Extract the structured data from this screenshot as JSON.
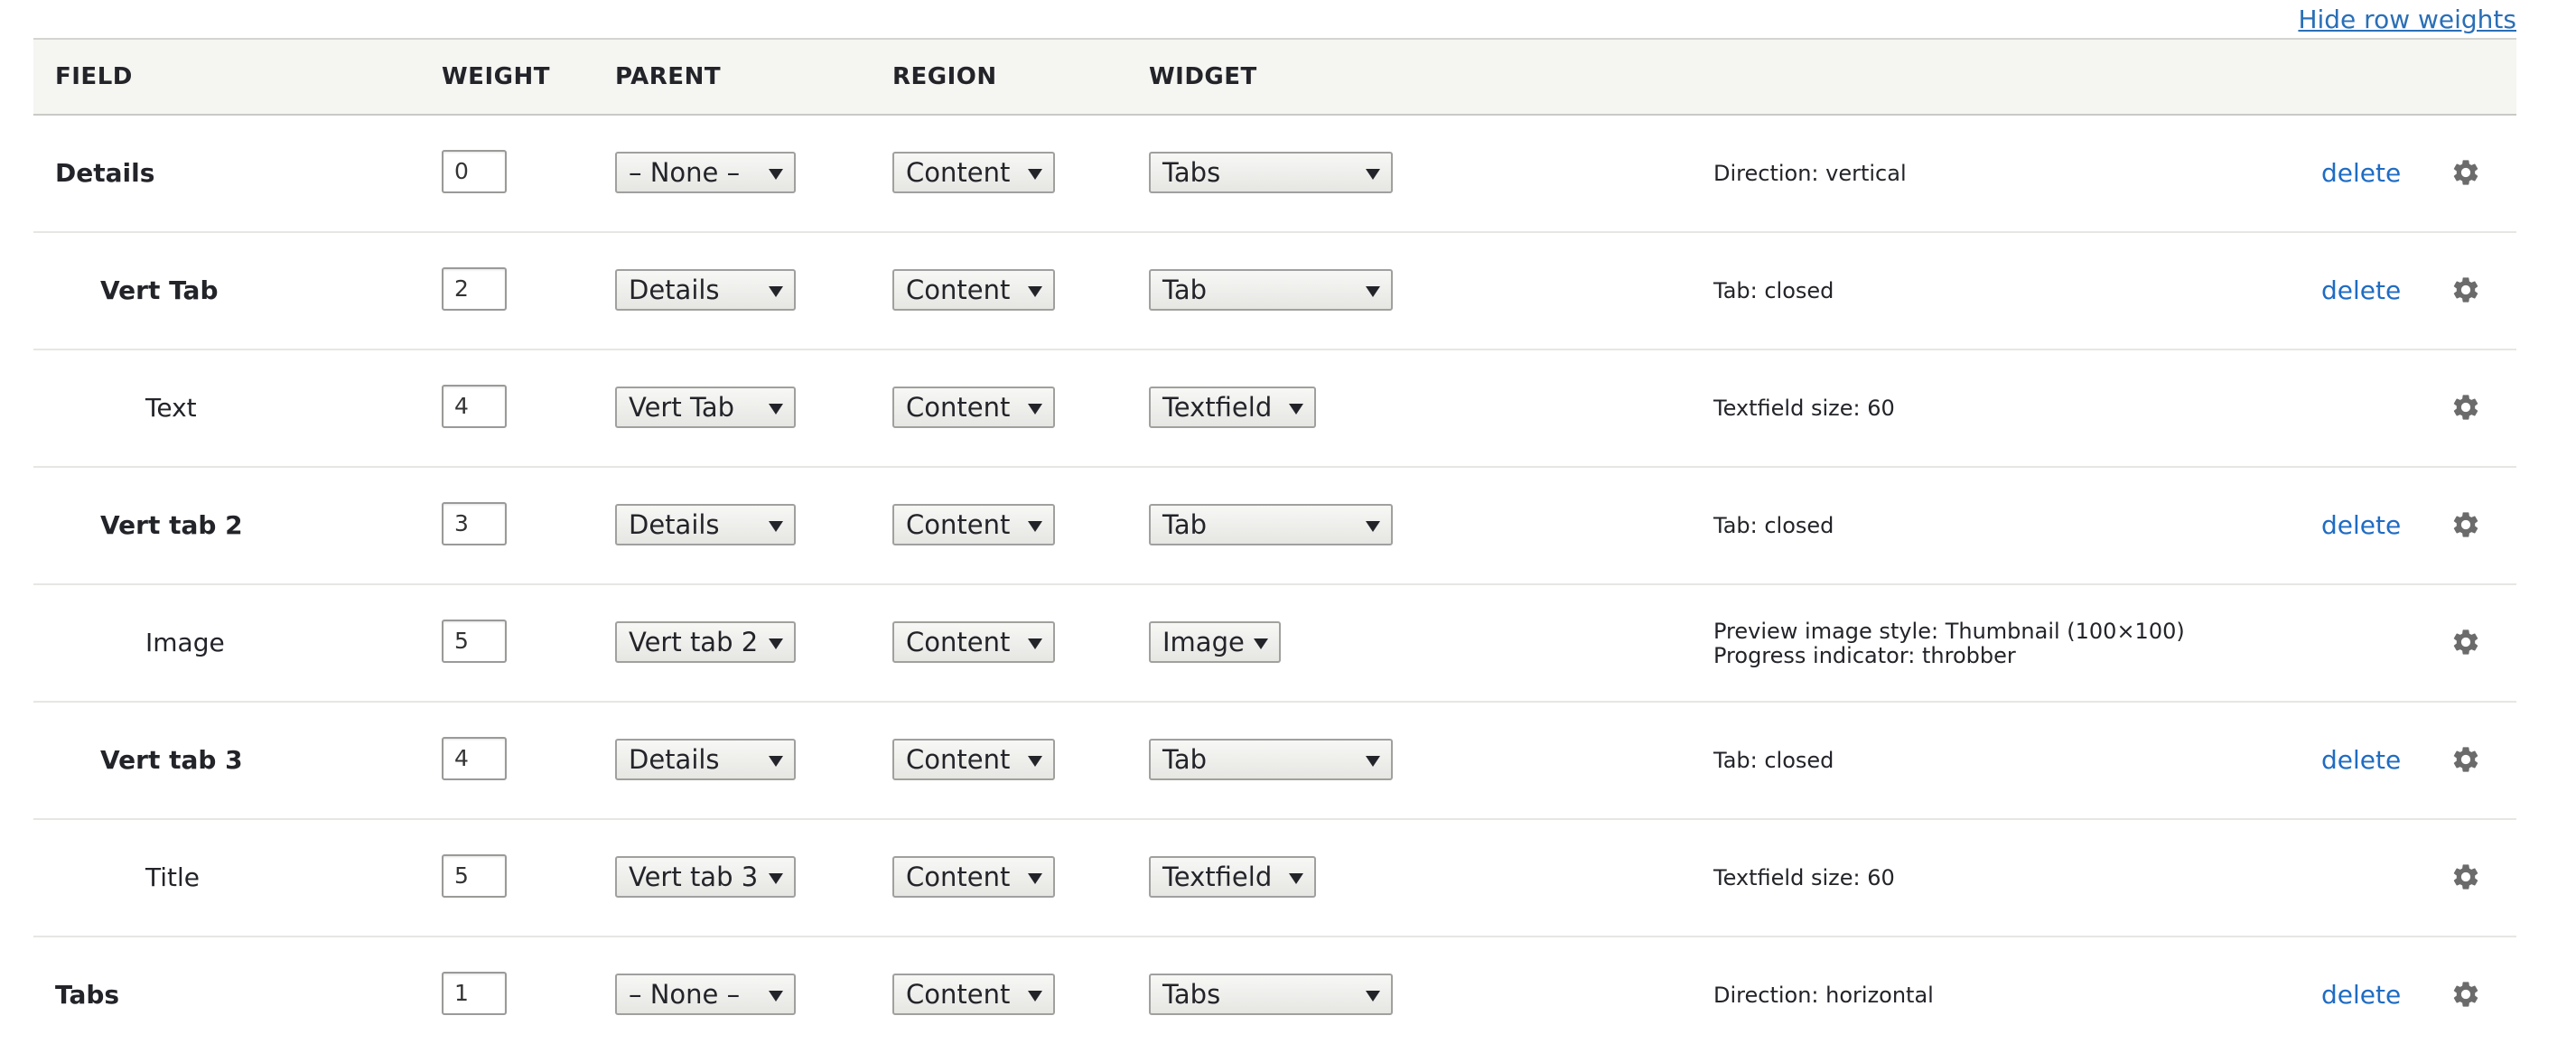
{
  "top_link": "Hide row weights",
  "headers": {
    "field": "Field",
    "weight": "Weight",
    "parent": "Parent",
    "region": "Region",
    "widget": "Widget"
  },
  "rows": [
    {
      "label": "Details",
      "weight": "0",
      "parent": "– None –",
      "region": "Content",
      "widget": "Tabs",
      "summary": [
        "Direction: vertical"
      ],
      "delete": "delete"
    },
    {
      "label": "Vert Tab",
      "weight": "2",
      "parent": "Details",
      "region": "Content",
      "widget": "Tab",
      "summary": [
        "Tab: closed"
      ],
      "delete": "delete"
    },
    {
      "label": "Text",
      "weight": "4",
      "parent": "Vert Tab",
      "region": "Content",
      "widget": "Textfield",
      "summary": [
        "Textfield size: 60"
      ],
      "delete": ""
    },
    {
      "label": "Vert tab 2",
      "weight": "3",
      "parent": "Details",
      "region": "Content",
      "widget": "Tab",
      "summary": [
        "Tab: closed"
      ],
      "delete": "delete"
    },
    {
      "label": "Image",
      "weight": "5",
      "parent": "Vert tab 2",
      "region": "Content",
      "widget": "Image",
      "summary": [
        "Preview image style: Thumbnail (100×100)",
        "Progress indicator: throbber"
      ],
      "delete": ""
    },
    {
      "label": "Vert tab 3",
      "weight": "4",
      "parent": "Details",
      "region": "Content",
      "widget": "Tab",
      "summary": [
        "Tab: closed"
      ],
      "delete": "delete"
    },
    {
      "label": "Title",
      "weight": "5",
      "parent": "Vert tab 3",
      "region": "Content",
      "widget": "Textfield",
      "summary": [
        "Textfield size: 60"
      ],
      "delete": ""
    },
    {
      "label": "Tabs",
      "weight": "1",
      "parent": "– None –",
      "region": "Content",
      "widget": "Tabs",
      "summary": [
        "Direction: horizontal"
      ],
      "delete": "delete"
    }
  ],
  "icons": {
    "settings": "gear-icon",
    "dropdown": "chevron-down-icon"
  },
  "colors": {
    "link": "#1f6cc3",
    "header_bg": "#f5f5f2",
    "border": "#e6e6e3"
  }
}
